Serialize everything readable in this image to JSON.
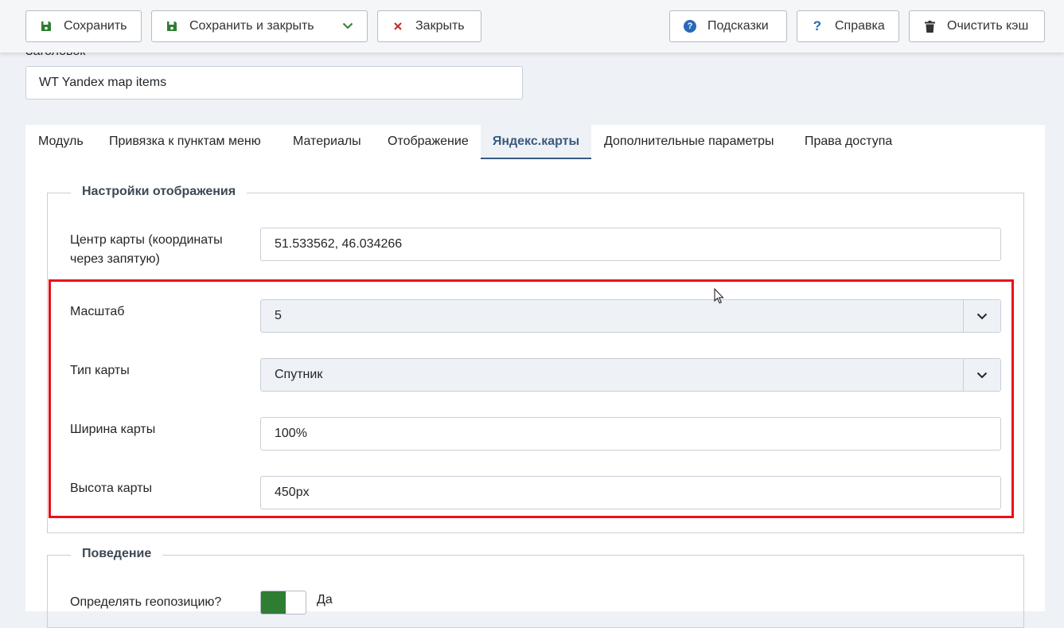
{
  "toolbar": {
    "save": "Сохранить",
    "save_close": "Сохранить и закрыть",
    "close": "Закрыть",
    "hints": "Подсказки",
    "help": "Справка",
    "clear_cache": "Очистить кэш",
    "icons": [
      "save-icon",
      "save-icon",
      "chevron-down-icon",
      "close-icon",
      "question-circle-icon",
      "question-icon",
      "trash-icon"
    ],
    "colors": {
      "save": "#2e7d32",
      "close": "#c62828",
      "hints": "#2a69b8"
    }
  },
  "title": {
    "label": "Заголовок",
    "value": "WT Yandex map items"
  },
  "tabs": [
    {
      "label": "Модуль"
    },
    {
      "label": "Привязка к пунктам меню"
    },
    {
      "label": "Материалы"
    },
    {
      "label": "Отображение"
    },
    {
      "label": "Яндекс.карты",
      "active": true
    },
    {
      "label": "Дополнительные параметры"
    },
    {
      "label": "Права доступа"
    }
  ],
  "display_settings": {
    "legend": "Настройки отображения",
    "center_label": "Центр карты (координаты через запятую)",
    "center_value": "51.533562, 46.034266",
    "zoom_label": "Масштаб",
    "zoom_value": "5",
    "type_label": "Тип карты",
    "type_value": "Спутник",
    "width_label": "Ширина карты",
    "width_value": "100%",
    "height_label": "Высота карты",
    "height_value": "450px",
    "highlight_color": "#e8101a"
  },
  "behavior": {
    "legend": "Поведение",
    "geo_label": "Определять геопозицию?",
    "geo_value": "Да",
    "toggle_color": "#2e7d32"
  }
}
